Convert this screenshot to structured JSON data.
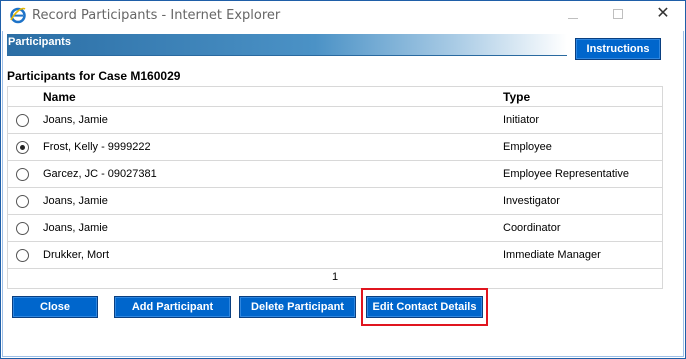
{
  "window": {
    "title": "Record Participants - Internet Explorer"
  },
  "header": {
    "band_label": "Participants",
    "instructions_label": "Instructions"
  },
  "section": {
    "title": "Participants for Case M160029"
  },
  "table": {
    "columns": [
      "Name",
      "Type"
    ],
    "rows": [
      {
        "name": "Joans, Jamie",
        "type": "Initiator",
        "selected": false
      },
      {
        "name": "Frost, Kelly - 9999222",
        "type": "Employee",
        "selected": true
      },
      {
        "name": "Garcez, JC - 09027381",
        "type": "Employee Representative",
        "selected": false
      },
      {
        "name": "Joans, Jamie",
        "type": "Investigator",
        "selected": false
      },
      {
        "name": "Joans, Jamie",
        "type": "Coordinator",
        "selected": false
      },
      {
        "name": "Drukker, Mort",
        "type": "Immediate Manager",
        "selected": false
      }
    ],
    "page": "1"
  },
  "buttons": {
    "close": "Close",
    "add": "Add Participant",
    "delete": "Delete Participant",
    "edit": "Edit Contact Details"
  },
  "colors": {
    "button_blue": "#0066cc",
    "highlight_red": "#e0151f",
    "window_border": "#1f5fa8"
  },
  "icons": {
    "app": "internet-explorer-icon",
    "minimize": "minimize-icon",
    "maximize": "maximize-icon",
    "close": "close-icon"
  }
}
